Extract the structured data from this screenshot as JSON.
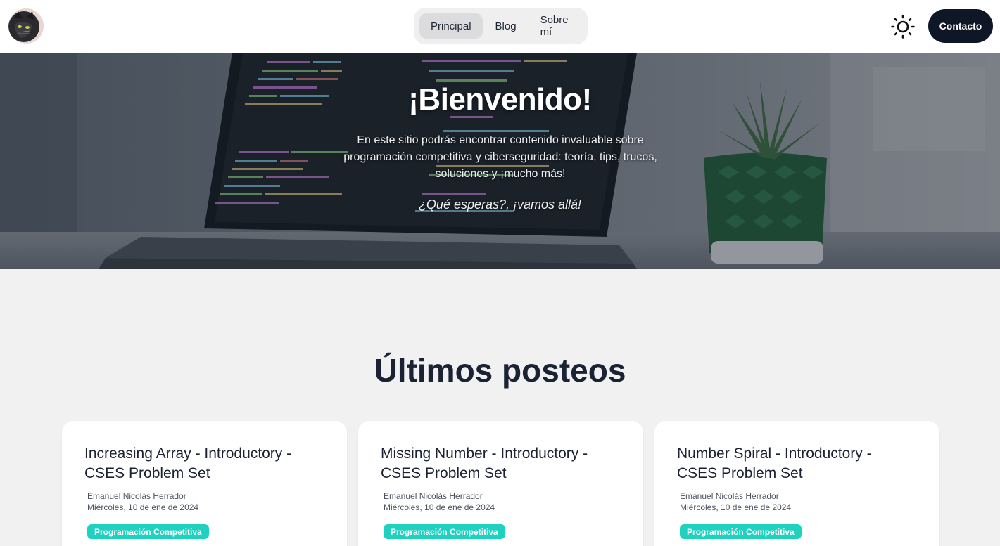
{
  "header": {
    "avatar_alt": "avatar",
    "nav": [
      {
        "label": "Principal",
        "active": true
      },
      {
        "label": "Blog",
        "active": false
      },
      {
        "label": "Sobre mí",
        "active": false
      }
    ],
    "theme_icon": "sun-icon",
    "contact_label": "Contacto"
  },
  "hero": {
    "title": "¡Bienvenido!",
    "description": "En este sitio podrás encontrar contenido invaluable sobre programación competitiva y ciberseguridad: teoría, tips, trucos, soluciones y ¡mucho más!",
    "cta": "¿Qué esperas?, ¡vamos allá!"
  },
  "posts": {
    "title": "Últimos posteos",
    "items": [
      {
        "title": "Increasing Array - Introductory - CSES Problem Set",
        "author": "Emanuel Nicolás Herrador",
        "date": "Miércoles, 10 de ene de 2024",
        "tag": "Programación Competitiva"
      },
      {
        "title": "Missing Number - Introductory - CSES Problem Set",
        "author": "Emanuel Nicolás Herrador",
        "date": "Miércoles, 10 de ene de 2024",
        "tag": "Programación Competitiva"
      },
      {
        "title": "Number Spiral - Introductory - CSES Problem Set",
        "author": "Emanuel Nicolás Herrador",
        "date": "Miércoles, 10 de ene de 2024",
        "tag": "Programación Competitiva"
      }
    ]
  },
  "colors": {
    "tag_bg": "#1fd1bf",
    "contact_bg": "#0f1625",
    "page_bg": "#f1f1f2"
  }
}
